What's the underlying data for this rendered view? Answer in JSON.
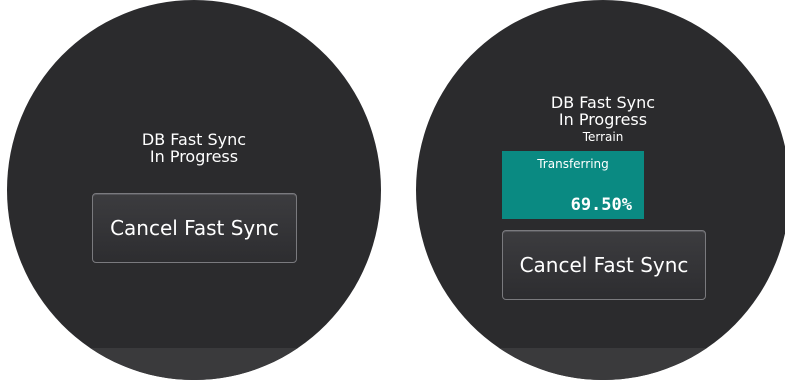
{
  "left_panel": {
    "status_line1": "DB Fast Sync",
    "status_line2": "In Progress",
    "cancel_label": "Cancel Fast Sync"
  },
  "right_panel": {
    "status_line1": "DB Fast Sync",
    "status_line2": "In Progress",
    "database_name": "Terrain",
    "progress_label": "Transferring",
    "progress_value": "69.50%",
    "progress_fraction": 0.695,
    "cancel_label": "Cancel Fast Sync"
  },
  "colors": {
    "dial_background": "#2b2b2d",
    "progress_accent": "#0a8a82",
    "text": "#ffffff"
  }
}
